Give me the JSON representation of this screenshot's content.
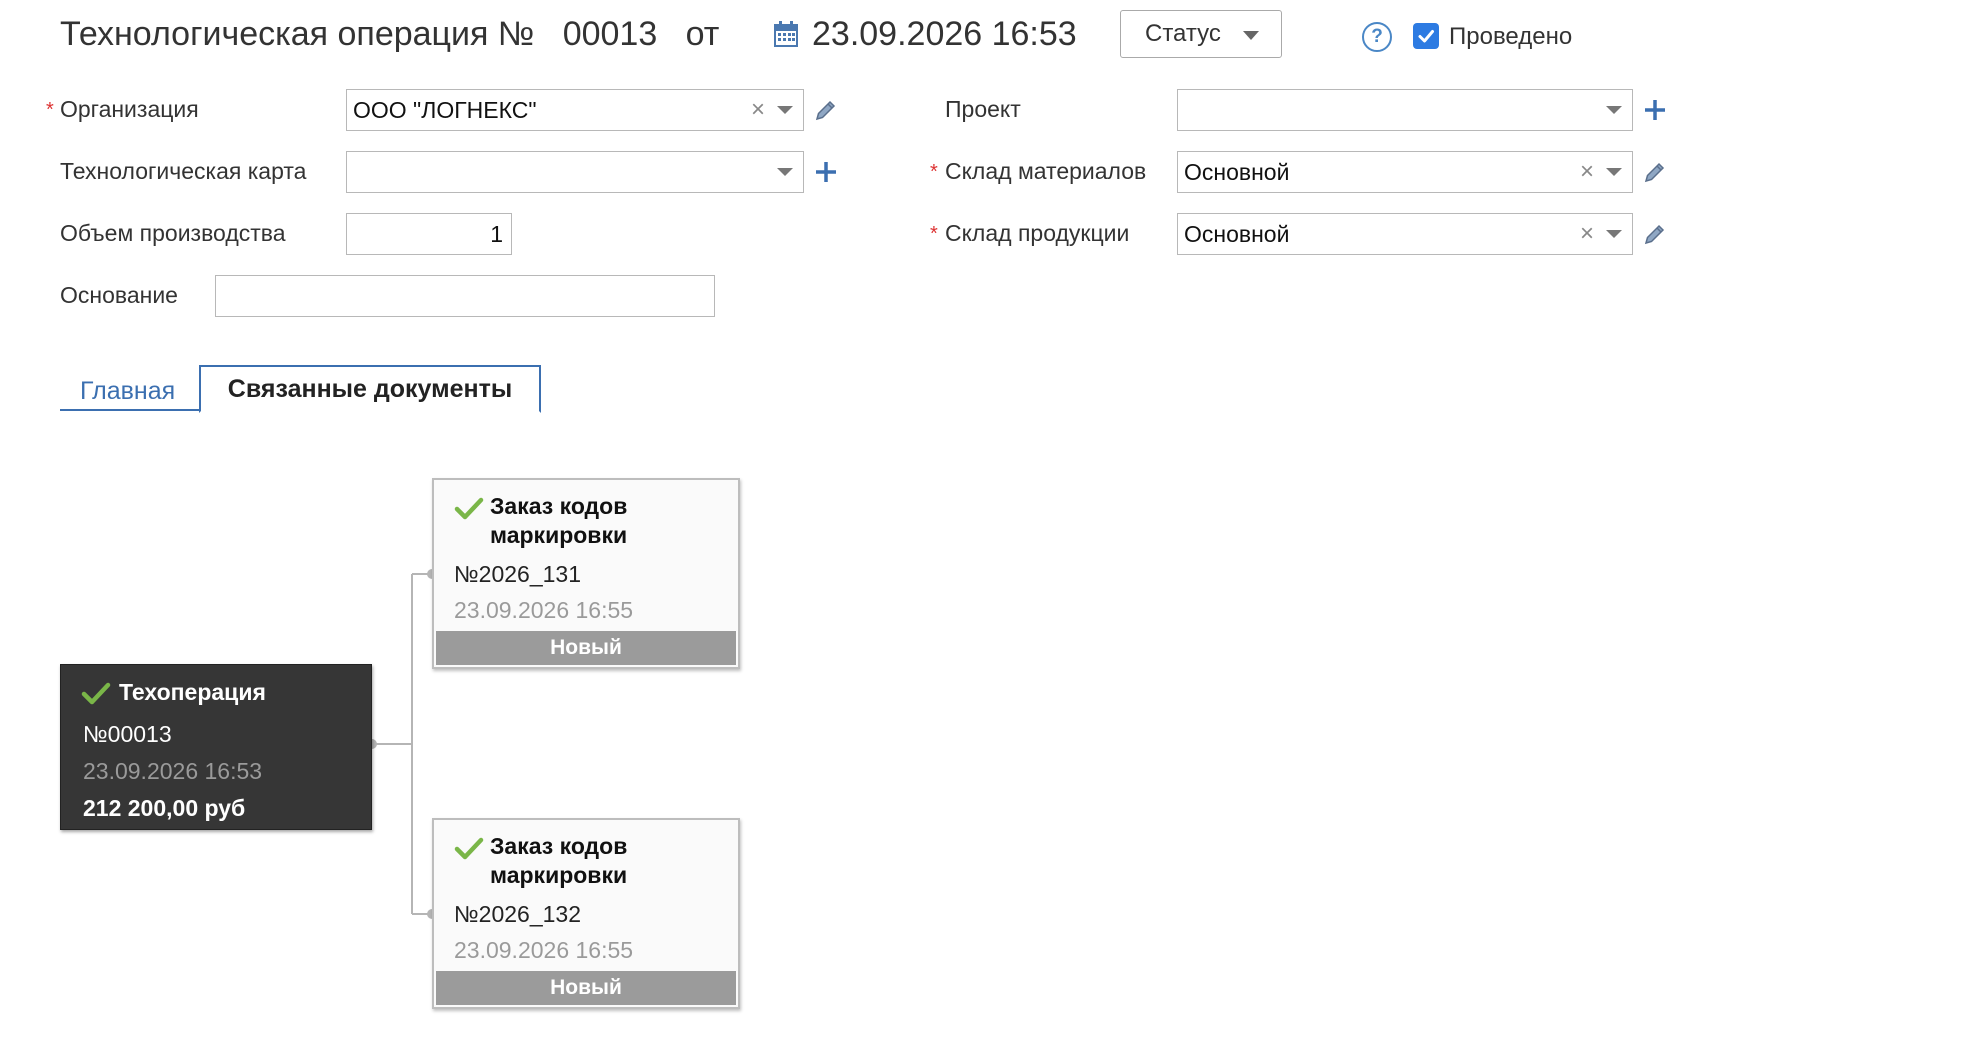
{
  "header": {
    "title_prefix": "Технологическая операция №",
    "number": "00013",
    "from_label": "от",
    "datetime": "23.09.2026 16:53",
    "status_button": "Статус",
    "help_symbol": "?",
    "posted_label": "Проведено",
    "posted_checked": true
  },
  "form": {
    "organization": {
      "label": "Организация",
      "value": "ООО \"ЛОГНЕКС\"",
      "required": true
    },
    "tech_card": {
      "label": "Технологическая карта",
      "value": ""
    },
    "volume": {
      "label": "Объем производства",
      "value": "1"
    },
    "basis": {
      "label": "Основание",
      "value": ""
    },
    "project": {
      "label": "Проект",
      "value": ""
    },
    "materials_warehouse": {
      "label": "Склад материалов",
      "value": "Основной",
      "required": true
    },
    "products_warehouse": {
      "label": "Склад продукции",
      "value": "Основной",
      "required": true
    },
    "required_mark": "*"
  },
  "tabs": [
    {
      "label": "Главная",
      "active": false
    },
    {
      "label": "Связанные документы",
      "active": true
    }
  ],
  "related": {
    "main": {
      "title": "Техоперация",
      "number": "№00013",
      "date": "23.09.2026 16:53",
      "sum": "212 200,00 руб"
    },
    "children": [
      {
        "title_line1": "Заказ кодов",
        "title_line2": "маркировки",
        "number": "№2026_131",
        "date": "23.09.2026 16:55",
        "status": "Новый"
      },
      {
        "title_line1": "Заказ кодов",
        "title_line2": "маркировки",
        "number": "№2026_132",
        "date": "23.09.2026 16:55",
        "status": "Новый"
      }
    ]
  },
  "colors": {
    "accent": "#3b6fb0",
    "check_green": "#7ab648",
    "required_red": "#d33333",
    "main_card_bg": "#363636",
    "status_bar": "#9b9b9b"
  }
}
